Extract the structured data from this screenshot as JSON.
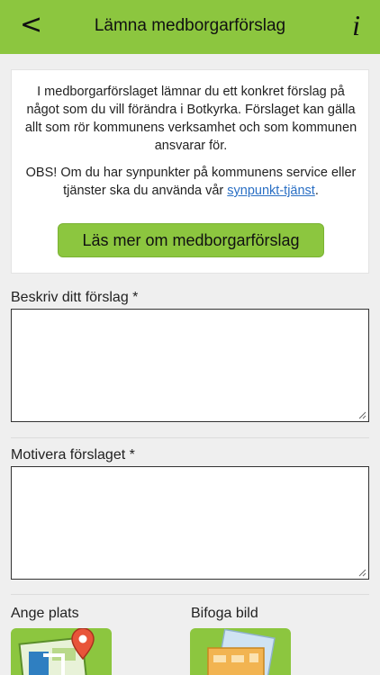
{
  "header": {
    "back_label": "<",
    "title": "Lämna medborgarförslag",
    "info_label": "i"
  },
  "intro": {
    "paragraph": "I medborgarförslaget lämnar du ett konkret förslag på något som du vill förändra i Botkyrka. Förslaget kan gälla allt som rör kommunens verksamhet och som kommunen ansvarar för.",
    "obs_text": "OBS! Om du har synpunkter på kommunens service eller tjänster ska du använda vår ",
    "obs_link": "synpunkt-tjänst",
    "obs_end": ".",
    "button_label": "Läs mer om medborgarförslag"
  },
  "form": {
    "describe_label": "Beskriv ditt förslag *",
    "describe_value": "",
    "motivate_label": "Motivera förslaget *",
    "motivate_value": "",
    "location_label": "Ange plats",
    "image_label": "Bifoga bild"
  },
  "icons": {
    "back": "chevron-left-icon",
    "info": "info-icon",
    "location": "map-pin-icon",
    "image": "photo-attach-icon"
  },
  "colors": {
    "accent": "#8cc63f",
    "link": "#2a6fc4",
    "background": "#efefef"
  }
}
